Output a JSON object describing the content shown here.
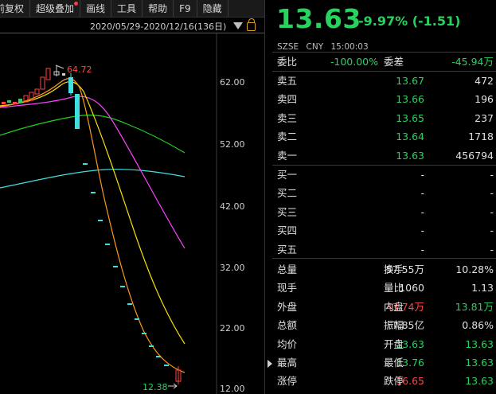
{
  "toolbar": {
    "items": [
      "前复权",
      "超级叠加",
      "画线",
      "工具",
      "帮助",
      "F9",
      "隐藏"
    ]
  },
  "chart": {
    "date_range": "2020/05/29-2020/12/16(136日)",
    "high_label": "64.72",
    "low_label": "12.38",
    "y_ticks": [
      "62.00",
      "52.00",
      "42.00",
      "32.00",
      "22.00",
      "12.00"
    ]
  },
  "quote": {
    "price": "13.63",
    "change": "-9.97% (-1.51)",
    "exchange": "SZSE",
    "currency": "CNY",
    "time": "15:00:03",
    "weibi_label": "委比",
    "weibi_value": "-100.00%",
    "weicha_label": "委差",
    "weicha_value": "-45.94万"
  },
  "asks": [
    {
      "label": "卖五",
      "price": "13.67",
      "volume": "472"
    },
    {
      "label": "卖四",
      "price": "13.66",
      "volume": "196"
    },
    {
      "label": "卖三",
      "price": "13.65",
      "volume": "237"
    },
    {
      "label": "卖二",
      "price": "13.64",
      "volume": "1718"
    },
    {
      "label": "卖一",
      "price": "13.63",
      "volume": "456794"
    }
  ],
  "bids": [
    {
      "label": "买一",
      "price": "-",
      "volume": "-"
    },
    {
      "label": "买二",
      "price": "-",
      "volume": "-"
    },
    {
      "label": "买三",
      "price": "-",
      "volume": "-"
    },
    {
      "label": "买四",
      "price": "-",
      "volume": "-"
    },
    {
      "label": "买五",
      "price": "-",
      "volume": "-"
    }
  ],
  "stats": [
    {
      "l1": "总量",
      "v1": "57.55万",
      "c1": "white",
      "l2": "换手",
      "v2": "10.28%",
      "c2": "white"
    },
    {
      "l1": "现手",
      "v1": "1060",
      "c1": "white",
      "l2": "量比",
      "v2": "1.13",
      "c2": "white"
    },
    {
      "l1": "外盘",
      "v1": "43.74万",
      "c1": "red",
      "l2": "内盘",
      "v2": "13.81万",
      "c2": "green"
    },
    {
      "l1": "总额",
      "v1": "7.85亿",
      "c1": "white",
      "l2": "振幅",
      "v2": "0.86%",
      "c2": "white"
    },
    {
      "l1": "均价",
      "v1": "13.63",
      "c1": "green",
      "l2": "开盘",
      "v2": "13.63",
      "c2": "green"
    },
    {
      "l1": "最高",
      "v1": "13.76",
      "c1": "green",
      "l2": "最低",
      "v2": "13.63",
      "c2": "green"
    },
    {
      "l1": "涨停",
      "v1": "16.65",
      "c1": "red",
      "l2": "跌停",
      "v2": "13.63",
      "c2": "green"
    }
  ],
  "colors": {
    "up": "#ff4545",
    "down": "#28d25e",
    "ma5": "#ffffff",
    "ma10": "#f5e000",
    "ma20": "#ff40ff",
    "ma30": "#20d020",
    "ma60": "#40e0e0",
    "ma_orange": "#ff9a1a"
  }
}
